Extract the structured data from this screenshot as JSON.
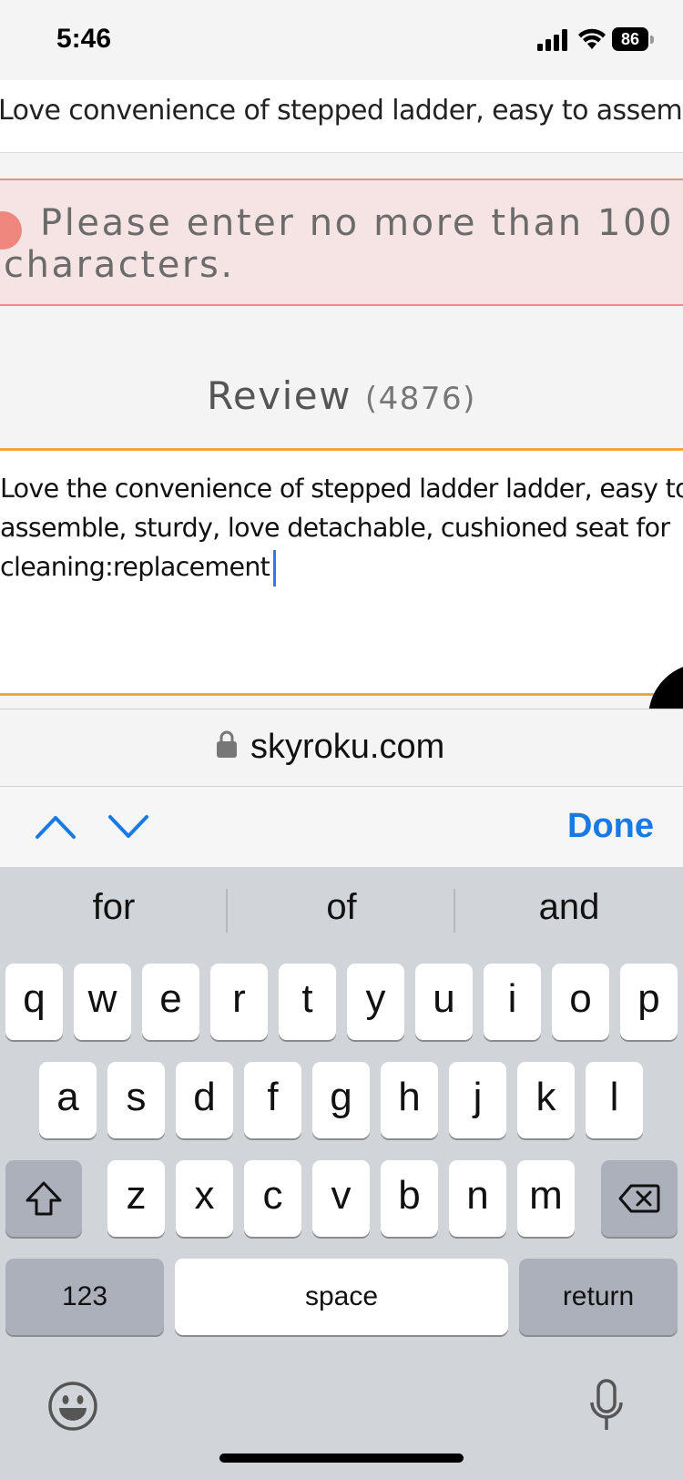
{
  "status_bar": {
    "time": "5:46",
    "battery": "86"
  },
  "page": {
    "title_field_value": "Love convenience of stepped ladder, easy to assemble",
    "error_message": "Please enter no more than 100 characters.",
    "review_label": "Review",
    "review_count": "(4876)",
    "review_text": "Love the convenience of stepped ladder ladder, easy to\nassemble, sturdy, love detachable, cushioned seat for\ncleaning:replacement"
  },
  "url_bar": {
    "domain": "skyroku.com"
  },
  "accessory": {
    "done_label": "Done"
  },
  "keyboard": {
    "suggestions": [
      "for",
      "of",
      "and"
    ],
    "row1": [
      "q",
      "w",
      "e",
      "r",
      "t",
      "y",
      "u",
      "i",
      "o",
      "p"
    ],
    "row2": [
      "a",
      "s",
      "d",
      "f",
      "g",
      "h",
      "j",
      "k",
      "l"
    ],
    "row3": [
      "z",
      "x",
      "c",
      "v",
      "b",
      "n",
      "m"
    ],
    "numbers_label": "123",
    "space_label": "space",
    "return_label": "return"
  },
  "colors": {
    "accent": "#1a7ae3",
    "error_border": "#e98c83",
    "review_border": "#f2a33a"
  }
}
